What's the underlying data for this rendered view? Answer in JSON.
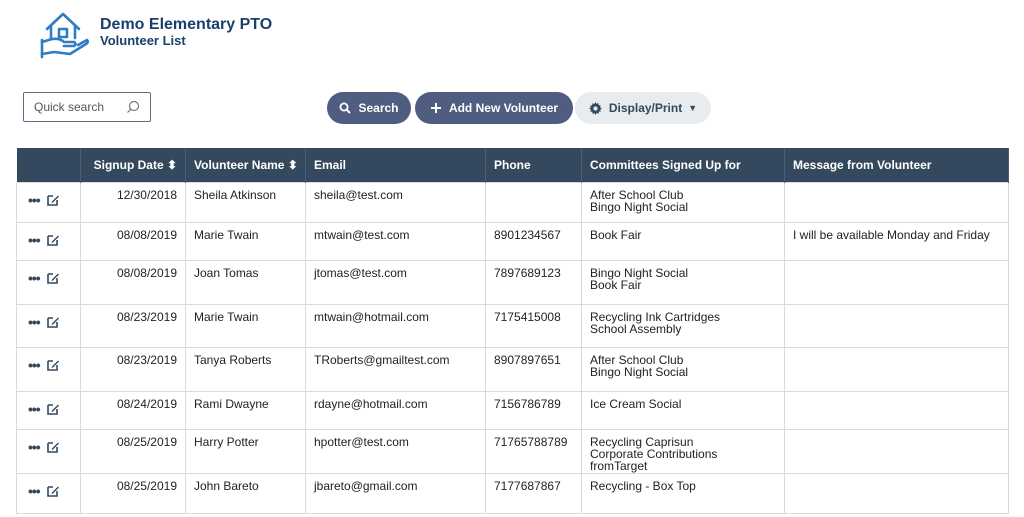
{
  "header": {
    "org_name": "Demo Elementary PTO",
    "page_subtitle": "Volunteer List"
  },
  "search": {
    "placeholder": "Quick search",
    "value": ""
  },
  "toolbar": {
    "search_label": "Search",
    "add_label": "Add New Volunteer",
    "display_label": "Display/Print"
  },
  "table": {
    "headers": [
      "",
      "Signup Date ⬍",
      "Volunteer Name ⬍",
      "Email",
      "Phone",
      "Committees Signed Up for",
      "Message from Volunteer"
    ],
    "rows": [
      {
        "date": "12/30/2018",
        "name": "Sheila Atkinson",
        "email": "sheila@test.com",
        "phone": "",
        "committees": [
          "After School Club",
          "Bingo Night Social"
        ],
        "message": ""
      },
      {
        "date": "08/08/2019",
        "name": "Marie Twain",
        "email": "mtwain@test.com",
        "phone": "8901234567",
        "committees": [
          "Book Fair"
        ],
        "message": "I will be available Monday and Friday"
      },
      {
        "date": "08/08/2019",
        "name": "Joan Tomas",
        "email": "jtomas@test.com",
        "phone": "7897689123",
        "committees": [
          "Bingo Night Social",
          "Book Fair"
        ],
        "message": ""
      },
      {
        "date": "08/23/2019",
        "name": "Marie Twain",
        "email": "mtwain@hotmail.com",
        "phone": "7175415008",
        "committees": [
          "Recycling Ink Cartridges",
          "School Assembly"
        ],
        "message": ""
      },
      {
        "date": "08/23/2019",
        "name": "Tanya Roberts",
        "email": "TRoberts@gmailtest.com",
        "phone": "8907897651",
        "committees": [
          "After School Club",
          "Bingo Night Social"
        ],
        "message": ""
      },
      {
        "date": "08/24/2019",
        "name": "Rami Dwayne",
        "email": "rdayne@hotmail.com",
        "phone": "7156786789",
        "committees": [
          "Ice Cream Social"
        ],
        "message": ""
      },
      {
        "date": "08/25/2019",
        "name": "Harry Potter",
        "email": "hpotter@test.com",
        "phone": "71765788789",
        "committees": [
          "Recycling Caprisun",
          "Corporate Contributions fromTarget"
        ],
        "message": ""
      },
      {
        "date": "08/25/2019",
        "name": "John Bareto",
        "email": "jbareto@gmail.com",
        "phone": "7177687867",
        "committees": [
          "Recycling - Box Top"
        ],
        "message": ""
      }
    ]
  },
  "colors": {
    "brand_navy": "#1b3f6d",
    "logo_blue": "#2e7cc4",
    "header_bg": "#34495e",
    "button_bg": "#4f5d80"
  },
  "icons": {
    "logo": "house-in-hand-logo",
    "search": "magnifier-icon",
    "add": "plus-icon",
    "display": "gear-icon",
    "row_more": "ellipsis-icon",
    "row_edit": "edit-icon"
  }
}
